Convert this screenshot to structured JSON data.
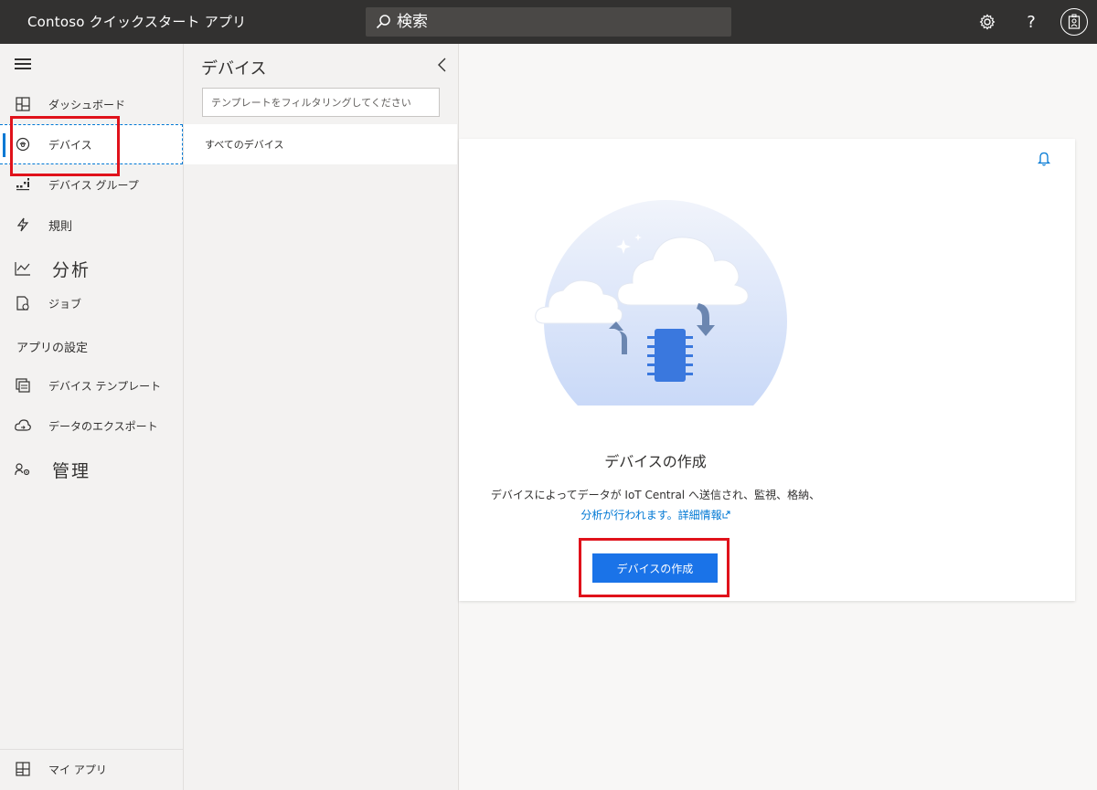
{
  "app": {
    "title": "Contoso クイックスタート アプリ"
  },
  "search": {
    "placeholder": "検索"
  },
  "nav": {
    "items": [
      {
        "label": "ダッシュボード"
      },
      {
        "label": "デバイス"
      },
      {
        "label": "デバイス グループ"
      },
      {
        "label": "規則"
      },
      {
        "label": "分析"
      },
      {
        "label": "ジョブ"
      }
    ],
    "section_app_settings": "アプリの設定",
    "settings_items": [
      {
        "label": "デバイス テンプレート"
      },
      {
        "label": "データのエクスポート"
      },
      {
        "label": "管理"
      }
    ],
    "bottom_item": "マイ アプリ"
  },
  "devices_panel": {
    "title": "デバイス",
    "filter_placeholder": "テンプレートをフィルタリングしてください",
    "all_devices": "すべてのデバイス"
  },
  "main": {
    "title": "デバイスの作成",
    "description_line1": "デバイスによってデータが IoT Central へ送信され、監視、格納、",
    "description_line2": "分析が行われます。",
    "learn_more": "詳細情報",
    "create_button": "デバイスの作成"
  },
  "colors": {
    "accent": "#0078d4",
    "button": "#1a73e8",
    "topbar": "#323130",
    "highlight": "#e0121b"
  }
}
